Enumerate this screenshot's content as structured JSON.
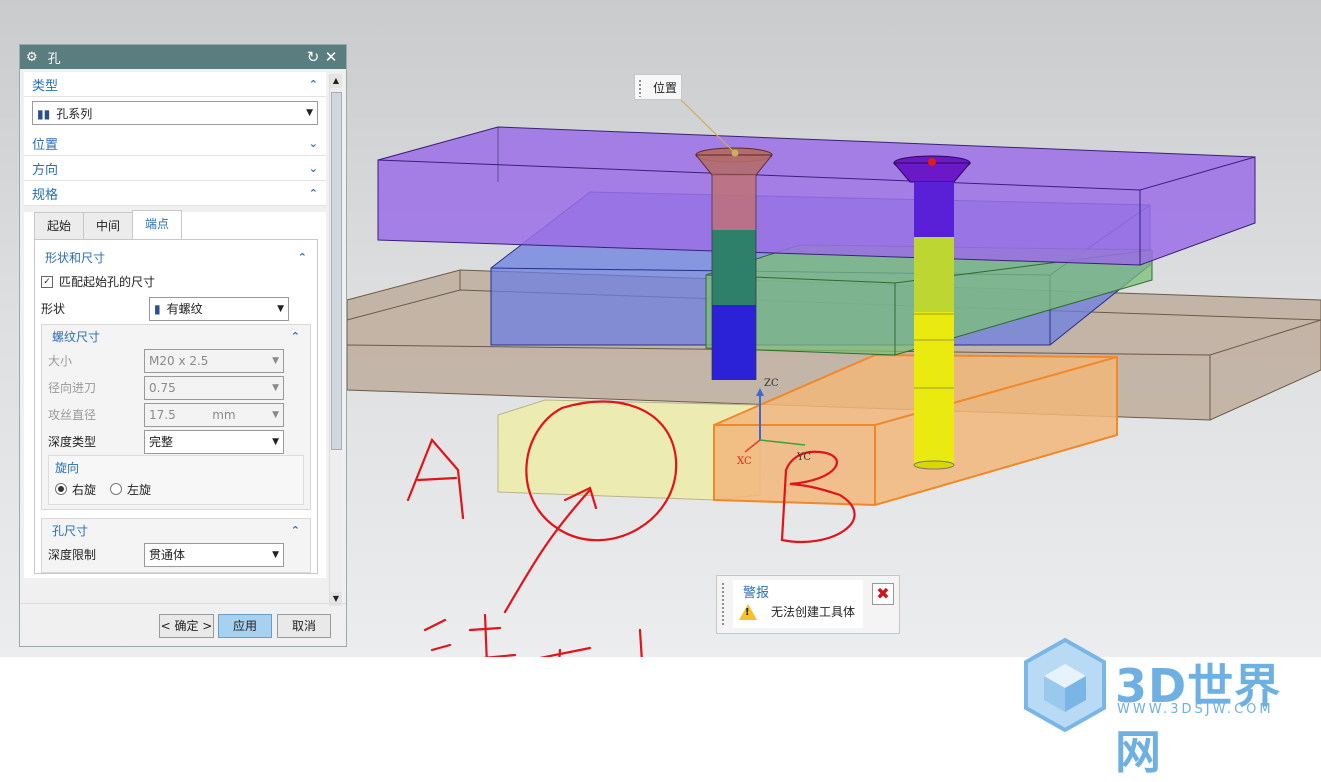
{
  "dialog": {
    "title": "孔",
    "sections": {
      "type": "类型",
      "position": "位置",
      "direction": "方向",
      "spec": "规格"
    },
    "type_value": "孔系列",
    "tabs": [
      "起始",
      "中间",
      "端点"
    ],
    "shape_group": "形状和尺寸",
    "match_checkbox": "匹配起始孔的尺寸",
    "shape_label": "形状",
    "shape_value": "有螺纹",
    "thread_group": "螺纹尺寸",
    "size_label": "大小",
    "size_value": "M20 x 2.5",
    "radial_label": "径向进刀",
    "radial_value": "0.75",
    "tap_label": "攻丝直径",
    "tap_value": "17.5",
    "tap_unit": "mm",
    "depth_type_label": "深度类型",
    "depth_type_value": "完整",
    "rotation_group": "旋向",
    "right_hand": "右旋",
    "left_hand": "左旋",
    "hole_group": "孔尺寸",
    "depth_limit_label": "深度限制",
    "depth_limit_value": "贯通体",
    "ok_button": "< 确定 >",
    "apply_button": "应用",
    "cancel_button": "取消"
  },
  "viewport": {
    "position_tag": "位置",
    "axis_zc": "ZC",
    "axis_xc": "XC",
    "axis_yc": "YC",
    "handwriting": {
      "letter_a": "A",
      "letter_b": "B",
      "caption": "选不上"
    }
  },
  "alert": {
    "title": "警报",
    "message": "无法创建工具体"
  },
  "watermark": {
    "brand": "3D世界网",
    "url": "WWW.3DSJW.COM"
  }
}
